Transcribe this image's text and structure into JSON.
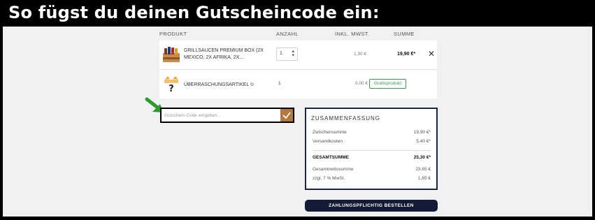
{
  "banner": {
    "title": "So fügst du deinen Gutscheincode ein:"
  },
  "table_header": {
    "product": "PRODUKT",
    "quantity": "ANZAHL",
    "price": "INKL. MWST.",
    "sum": "SUMME"
  },
  "items": [
    {
      "name_line1": "GRILLSAUCEN PREMIUM BOX (2X",
      "name_line2": "MEXICO, 2X AFRIKA, 2X...",
      "quantity": "1",
      "price": "1,30 €",
      "total": "19,90 €*"
    },
    {
      "name": "ÜBERRASCHUNGSARTIKEL",
      "quantity": "1",
      "price": "0,00 €",
      "badge": "Gratisprodukt"
    }
  ],
  "coupon": {
    "placeholder": "Gutschein-Code eingeben..."
  },
  "summary": {
    "title": "ZUSAMMENFASSUNG",
    "subtotal_label": "Zwischensumme",
    "subtotal": "19,90 €*",
    "shipping_label": "Versandkosten",
    "shipping": "5,40 €*",
    "total_label": "GESAMTSUMME",
    "total": "25,30 €*",
    "net_label": "Gesamtnettosumme",
    "net": "23,65 €",
    "vat_label": "zzgl. 7 % MwSt.",
    "vat": "1,65 €"
  },
  "order_button": "ZAHLUNGSPFLICHTIG BESTELLEN",
  "colors": {
    "navy": "#141b34",
    "accent": "#b4783d",
    "green": "#3e9a48",
    "arrow": "#2e9a2e"
  },
  "icons": {
    "remove": "close-icon",
    "external": "external-link-icon",
    "submit": "checkmark-icon",
    "pointer": "arrow-icon"
  }
}
